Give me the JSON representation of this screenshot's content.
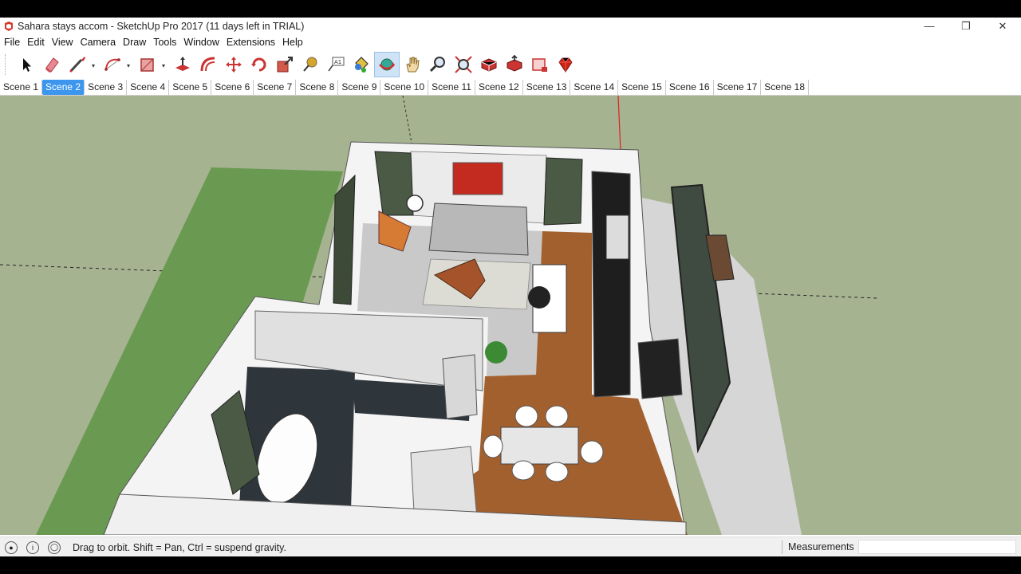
{
  "window": {
    "title": "Sahara stays accom - SketchUp Pro 2017 (11 days left in TRIAL)",
    "controls": {
      "minimize": "—",
      "restore": "❐",
      "close": "✕"
    }
  },
  "menu": [
    "File",
    "Edit",
    "View",
    "Camera",
    "Draw",
    "Tools",
    "Window",
    "Extensions",
    "Help"
  ],
  "toolbar": {
    "tools": [
      {
        "name": "select-tool-icon"
      },
      {
        "name": "eraser-tool-icon"
      },
      {
        "name": "line-tool-icon",
        "dropdown": true
      },
      {
        "name": "arc-tool-icon",
        "dropdown": true
      },
      {
        "name": "rectangle-tool-icon",
        "dropdown": true
      },
      {
        "name": "push-pull-tool-icon"
      },
      {
        "name": "offset-tool-icon"
      },
      {
        "name": "move-tool-icon"
      },
      {
        "name": "rotate-tool-icon"
      },
      {
        "name": "scale-tool-icon"
      },
      {
        "name": "tape-measure-tool-icon"
      },
      {
        "name": "text-tool-icon"
      },
      {
        "name": "paint-bucket-tool-icon"
      },
      {
        "name": "orbit-tool-icon",
        "active": true
      },
      {
        "name": "pan-tool-icon"
      },
      {
        "name": "zoom-tool-icon"
      },
      {
        "name": "zoom-extents-tool-icon"
      },
      {
        "name": "3d-warehouse-icon"
      },
      {
        "name": "share-model-icon"
      },
      {
        "name": "extension-warehouse-icon"
      },
      {
        "name": "ruby-console-icon"
      }
    ]
  },
  "scenes": {
    "tabs": [
      "Scene 1",
      "Scene 2",
      "Scene 3",
      "Scene 4",
      "Scene 5",
      "Scene 6",
      "Scene 7",
      "Scene 8",
      "Scene 9",
      "Scene 10",
      "Scene 11",
      "Scene 12",
      "Scene 13",
      "Scene 14",
      "Scene 15",
      "Scene 16",
      "Scene 17",
      "Scene 18"
    ],
    "active": "Scene 2"
  },
  "statusbar": {
    "hint": "Drag to orbit. Shift = Pan, Ctrl = suspend gravity.",
    "measurements_label": "Measurements",
    "measurements_value": ""
  },
  "colors": {
    "sky_ground": "#a6b391",
    "lawn": "#6a9a52",
    "floor_wood": "#a3602f",
    "wall": "#f4f4f4",
    "active_tab": "#3c96ee"
  }
}
